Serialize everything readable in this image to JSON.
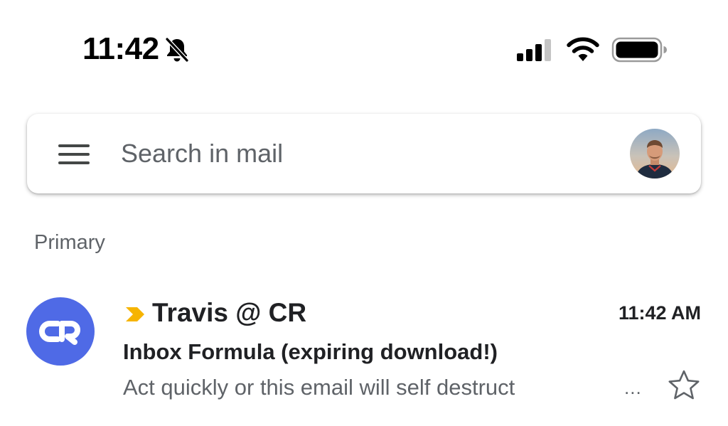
{
  "status_bar": {
    "time": "11:42",
    "icons": [
      "bell-muted-icon",
      "cellular-signal-icon",
      "wifi-icon",
      "battery-icon"
    ]
  },
  "search": {
    "placeholder": "Search in mail",
    "value": ""
  },
  "category": {
    "label": "Primary"
  },
  "email": {
    "sender": "Travis @ CR",
    "time": "11:42 AM",
    "subject": "Inbox Formula (expiring download!)",
    "snippet": "Act quickly or this email will self destruct",
    "more": "...",
    "starred": false,
    "important": true,
    "avatar_color": "#4f6ae6"
  },
  "colors": {
    "importance_marker": "#f6b400",
    "text_primary": "#202124",
    "text_secondary": "#5f6368"
  }
}
